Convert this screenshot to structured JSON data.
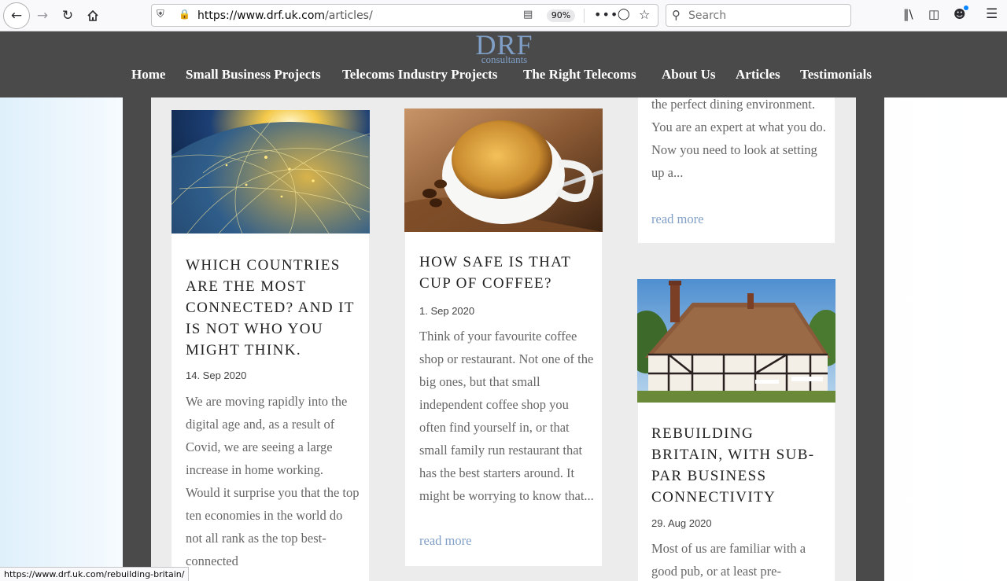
{
  "browser": {
    "url_domain": "https://www.drf.uk.com",
    "url_path": "/articles/",
    "zoom": "90%",
    "search_placeholder": "Search",
    "status_url": "https://www.drf.uk.com/rebuilding-britain/"
  },
  "site": {
    "logo_main": "DRF",
    "logo_sub": "consultants",
    "nav": [
      "Home",
      "Small Business Projects",
      "Telecoms Industry Projects",
      "The Right Telecoms",
      "About Us",
      "Articles",
      "Testimonials"
    ]
  },
  "articles": [
    {
      "title": "WHICH COUNTRIES ARE THE MOST CONNECTED? AND IT IS NOT WHO YOU MIGHT THINK.",
      "date": "14. Sep 2020",
      "excerpt": "We are moving rapidly into the digital age and, as a result of Covid, we are seeing a large increase in home working. Would it surprise you that the top ten economies in the world do not all rank as the top best-connected"
    },
    {
      "title": "HOW SAFE IS THAT CUP OF COFFEE?",
      "date": "1. Sep 2020",
      "excerpt": "Think of your favourite coffee shop or restaurant. Not one of the big ones, but that small independent coffee shop you often find yourself in, or that small family run restaurant that has the best starters around. It might be worrying to know that...",
      "read_more": "read more"
    },
    {
      "excerpt": "the perfect dining environment. You are an expert at what you do. Now you need to look at setting up a...",
      "read_more": "read more"
    },
    {
      "title": "REBUILDING BRITAIN, WITH SUB-PAR BUSINESS CONNECTIVITY",
      "date": "29. Aug 2020",
      "excerpt": "Most of us are familiar with a good pub, or at least pre-"
    }
  ],
  "colors": {
    "header_bg": "#4a4a4a",
    "logo": "#7f9fc6",
    "link": "#7f9fc6",
    "content_bg": "#ececec"
  }
}
